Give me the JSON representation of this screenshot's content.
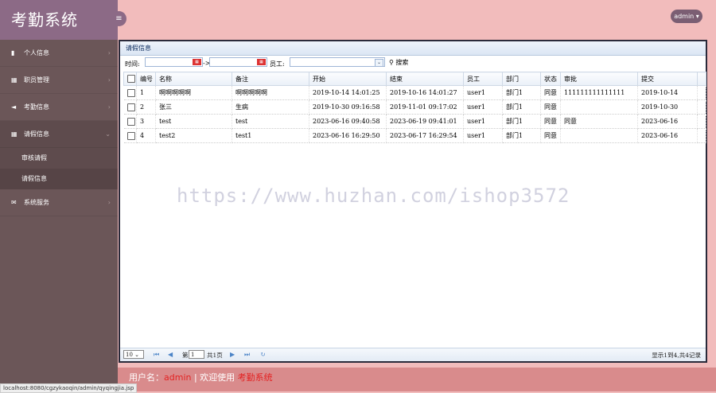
{
  "app": {
    "title": "考勤系统",
    "admin_label": "admin ▾",
    "menu_toggle_icon": "≡"
  },
  "sidebar": {
    "items": [
      {
        "label": "个人信息",
        "icon": "book-icon"
      },
      {
        "label": "职员管理",
        "icon": "grid-icon"
      },
      {
        "label": "考勤信息",
        "icon": "megaphone-icon"
      },
      {
        "label": "请假信息",
        "icon": "grid-icon"
      },
      {
        "label": "系统服务",
        "icon": "envelope-icon"
      }
    ],
    "submenu": [
      {
        "label": "审核请假"
      },
      {
        "label": "请假信息"
      }
    ]
  },
  "panel": {
    "title": "请假信息",
    "filters": {
      "time_label": "时间:",
      "arrow": "->",
      "employee_label": "员工:",
      "search_label": "搜索"
    },
    "columns": [
      "编号",
      "名称",
      "备注",
      "开始",
      "结束",
      "员工",
      "部门",
      "状态",
      "审批",
      "提交"
    ],
    "rows": [
      [
        "1",
        "啊啊啊啊啊",
        "啊啊啊啊啊",
        "2019-10-14 14:01:25",
        "2019-10-16 14:01:27",
        "user1",
        "部门1",
        "同意",
        "111111111111111",
        "2019-10-14"
      ],
      [
        "2",
        "张三",
        "生病",
        "2019-10-30 09:16:58",
        "2019-11-01 09:17:02",
        "user1",
        "部门1",
        "同意",
        "",
        "2019-10-30"
      ],
      [
        "3",
        "test",
        "test",
        "2023-06-16 09:40:58",
        "2023-06-19 09:41:01",
        "user1",
        "部门1",
        "同意",
        "同意",
        "2023-06-16"
      ],
      [
        "4",
        "test2",
        "test1",
        "2023-06-16 16:29:50",
        "2023-06-17 16:29:54",
        "user1",
        "部门1",
        "同意",
        "",
        "2023-06-16"
      ]
    ],
    "pager": {
      "page_size": "10",
      "page_label": "第",
      "page_value": "1",
      "total_pages": "共1页",
      "summary": "显示1到4,共4记录"
    }
  },
  "watermark": "https://www.huzhan.com/ishop3572",
  "footer": {
    "prefix": "用户名：",
    "user": "admin",
    "middle": " | 欢迎使用 ",
    "system": "考勤系统"
  },
  "status_url": "localhost:8080/cgzykaoqin/admin/qyqingjia.jsp",
  "colors": {
    "sidebar": "#6b5658",
    "logo_bg": "#8c6a86",
    "page_bg": "#f2bcbc",
    "footer": "#d98b8c",
    "accent_red": "#e32222"
  }
}
